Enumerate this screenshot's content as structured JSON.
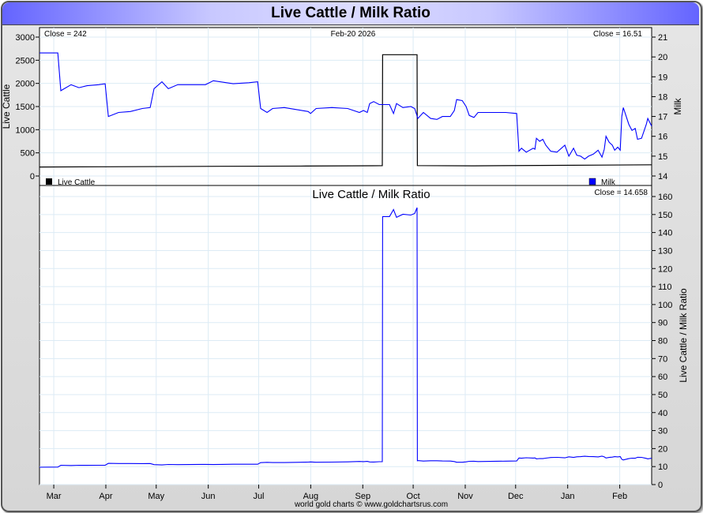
{
  "title": "Live Cattle / Milk Ratio",
  "footer": "world gold charts © www.goldchartsrus.com",
  "chart_data": [
    {
      "type": "line",
      "panel": "top",
      "date_label": "Feb-20  2026",
      "x_unit": "days since 2025-03-01",
      "xlim": [
        -8.5,
        356
      ],
      "month_ticks": [
        {
          "label": "Mar",
          "day": 0
        },
        {
          "label": "Apr",
          "day": 31
        },
        {
          "label": "May",
          "day": 61
        },
        {
          "label": "Jun",
          "day": 92
        },
        {
          "label": "Jul",
          "day": 122
        },
        {
          "label": "Aug",
          "day": 153
        },
        {
          "label": "Sep",
          "day": 184
        },
        {
          "label": "Oct",
          "day": 214
        },
        {
          "label": "Nov",
          "day": 245
        },
        {
          "label": "Dec",
          "day": 275
        },
        {
          "label": "Jan",
          "day": 306
        },
        {
          "label": "Feb",
          "day": 337
        }
      ],
      "left_axis": {
        "label": "Live Cattle",
        "ylim": [
          0,
          3000
        ],
        "ticks": [
          0,
          500,
          1000,
          1500,
          2000,
          2500,
          3000
        ]
      },
      "right_axis": {
        "label": "Milk",
        "ylim": [
          14,
          21
        ],
        "ticks": [
          14,
          15,
          16,
          17,
          18,
          19,
          20,
          21
        ]
      },
      "series": [
        {
          "name": "Live Cattle",
          "axis": "left",
          "color": "#000000",
          "close_label": "Close = 242",
          "points": [
            [
              -8.5,
              195
            ],
            [
              30,
              200
            ],
            [
              100,
              210
            ],
            [
              150,
              215
            ],
            [
              190,
              222
            ],
            [
              195.6,
              224
            ],
            [
              195.8,
              2620
            ],
            [
              216.3,
              2620
            ],
            [
              216.5,
              225
            ],
            [
              250,
              220
            ],
            [
              300,
              230
            ],
            [
              356,
              242
            ]
          ]
        },
        {
          "name": "Milk",
          "axis": "right",
          "color": "#0000ff",
          "close_label": "Close = 16.51",
          "points": [
            [
              -8.5,
              20.2
            ],
            [
              2.4,
              20.2
            ],
            [
              4.2,
              18.3
            ],
            [
              10.3,
              18.6
            ],
            [
              15,
              18.45
            ],
            [
              19.8,
              18.55
            ],
            [
              26.8,
              18.6
            ],
            [
              30.6,
              18.65
            ],
            [
              32.5,
              17.0
            ],
            [
              38.6,
              17.2
            ],
            [
              45.6,
              17.25
            ],
            [
              52.7,
              17.4
            ],
            [
              57.4,
              17.45
            ],
            [
              59.7,
              18.4
            ],
            [
              64.4,
              18.75
            ],
            [
              68.2,
              18.4
            ],
            [
              73.8,
              18.6
            ],
            [
              80.9,
              18.6
            ],
            [
              90.3,
              18.6
            ],
            [
              95,
              18.8
            ],
            [
              106.8,
              18.65
            ],
            [
              116.2,
              18.7
            ],
            [
              121.4,
              18.75
            ],
            [
              123.2,
              17.4
            ],
            [
              127,
              17.2
            ],
            [
              130.3,
              17.4
            ],
            [
              137.3,
              17.45
            ],
            [
              144.4,
              17.35
            ],
            [
              151.5,
              17.25
            ],
            [
              152.9,
              17.15
            ],
            [
              156.2,
              17.4
            ],
            [
              165.6,
              17.45
            ],
            [
              175,
              17.4
            ],
            [
              182,
              17.2
            ],
            [
              184.4,
              17.3
            ],
            [
              186.7,
              17.2
            ],
            [
              188.1,
              17.65
            ],
            [
              190.5,
              17.75
            ],
            [
              193.8,
              17.6
            ],
            [
              199.9,
              17.6
            ],
            [
              202.3,
              17.15
            ],
            [
              204.1,
              17.65
            ],
            [
              207.9,
              17.45
            ],
            [
              212.6,
              17.5
            ],
            [
              214.9,
              17.4
            ],
            [
              216.8,
              16.9
            ],
            [
              220.1,
              17.2
            ],
            [
              224.4,
              16.9
            ],
            [
              228.1,
              16.85
            ],
            [
              231.4,
              17.0
            ],
            [
              236.1,
              17.0
            ],
            [
              238.5,
              17.3
            ],
            [
              239.9,
              17.85
            ],
            [
              243.2,
              17.8
            ],
            [
              245.5,
              17.5
            ],
            [
              247.4,
              17.05
            ],
            [
              250.2,
              16.95
            ],
            [
              252.6,
              17.2
            ],
            [
              269.1,
              17.2
            ],
            [
              275.6,
              17.15
            ],
            [
              277,
              15.25
            ],
            [
              278.5,
              15.4
            ],
            [
              281.3,
              15.2
            ],
            [
              285.5,
              15.4
            ],
            [
              286.5,
              15.35
            ],
            [
              287.4,
              15.9
            ],
            [
              289.3,
              15.75
            ],
            [
              291.2,
              15.85
            ],
            [
              293,
              15.55
            ],
            [
              295.9,
              15.25
            ],
            [
              299.6,
              15.2
            ],
            [
              304.3,
              15.55
            ],
            [
              306.7,
              15.0
            ],
            [
              309.5,
              15.4
            ],
            [
              311.4,
              15.05
            ],
            [
              313.7,
              15.0
            ],
            [
              316.1,
              14.85
            ],
            [
              318.4,
              15.0
            ],
            [
              321.3,
              15.1
            ],
            [
              324.1,
              15.3
            ],
            [
              326.4,
              14.95
            ],
            [
              327.8,
              15.35
            ],
            [
              328.8,
              16.0
            ],
            [
              330.7,
              15.7
            ],
            [
              332.6,
              15.55
            ],
            [
              334,
              15.3
            ],
            [
              335.8,
              15.45
            ],
            [
              337.3,
              15.3
            ],
            [
              338.2,
              17.0
            ],
            [
              339.1,
              17.45
            ],
            [
              342.4,
              16.6
            ],
            [
              344.3,
              16.3
            ],
            [
              346.2,
              16.4
            ],
            [
              347.6,
              15.85
            ],
            [
              350,
              15.9
            ],
            [
              352.8,
              16.6
            ],
            [
              353.7,
              16.9
            ],
            [
              356,
              16.51
            ]
          ]
        }
      ]
    },
    {
      "type": "line",
      "panel": "bottom",
      "title": "Live Cattle  /  Milk Ratio",
      "close_label": "Close = 14.658",
      "right_axis": {
        "label": "Live Cattle / Milk Ratio",
        "ylim": [
          0,
          160
        ],
        "ticks": [
          0,
          10,
          20,
          30,
          40,
          50,
          60,
          70,
          80,
          90,
          100,
          110,
          120,
          130,
          140,
          150,
          160
        ]
      },
      "series": [
        {
          "name": "Live Cattle / Milk Ratio",
          "color": "#0000ff",
          "derived": "Live Cattle / Milk"
        }
      ]
    }
  ]
}
